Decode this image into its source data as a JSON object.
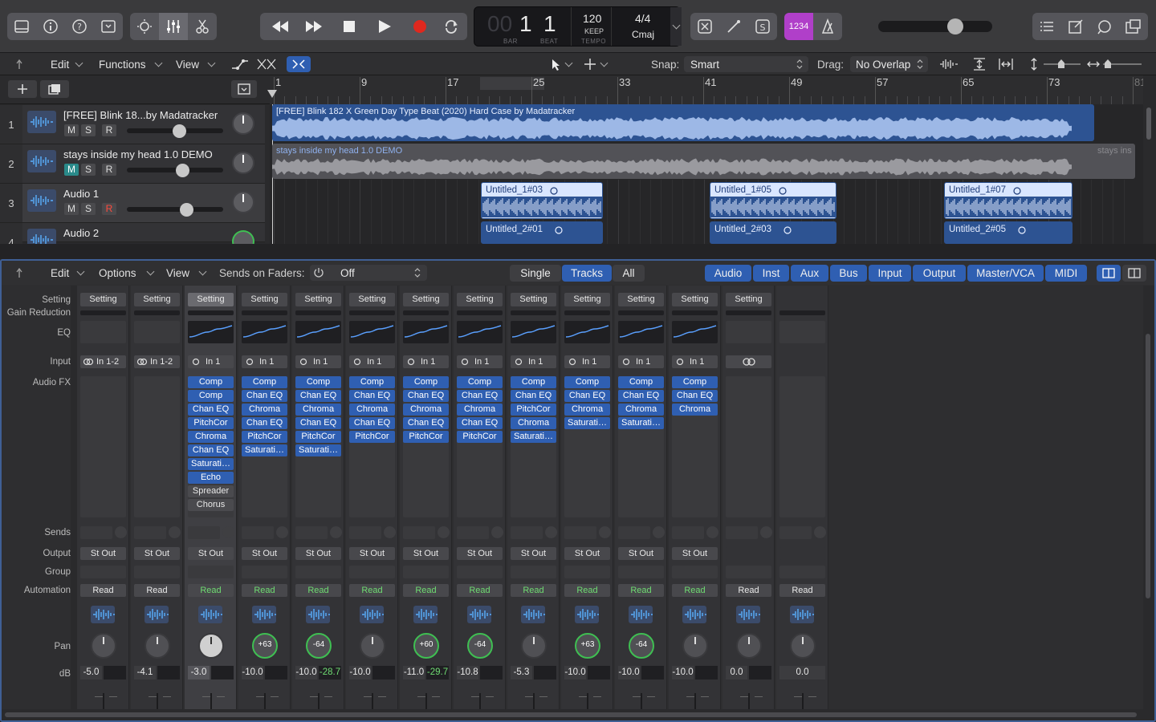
{
  "lcd": {
    "bar": "1",
    "beat": "1",
    "tempo": "120",
    "tempo_mode": "KEEP",
    "tempo_label": "TEMPO",
    "signature": "4/4",
    "key": "Cmaj",
    "bar_label": "BAR",
    "beat_label": "BEAT",
    "dim": "00"
  },
  "smart_controls": "1234",
  "tracks_toolbar": {
    "edit": "Edit",
    "functions": "Functions",
    "view": "View",
    "snap_label": "Snap:",
    "snap_value": "Smart",
    "drag_label": "Drag:",
    "drag_value": "No Overlap"
  },
  "ruler": [
    "1",
    "9",
    "17",
    "25",
    "33",
    "41",
    "49",
    "57",
    "65",
    "73",
    "81"
  ],
  "tracks": [
    {
      "num": "1",
      "name": "[FREE] Blink 18...by Madatracker",
      "m": "M",
      "s": "S",
      "r": "R",
      "volume": 0.52
    },
    {
      "num": "2",
      "name": "stays inside my head 1.0 DEMO",
      "m": "M",
      "s": "S",
      "r": "R",
      "volume": 0.55
    },
    {
      "num": "3",
      "name": "Audio 1",
      "m": "M",
      "s": "S",
      "r": "R",
      "volume": 0.6
    },
    {
      "num": "4",
      "name": "Audio 2"
    }
  ],
  "regions": {
    "r1": "[FREE] Blink 182 X Green Day Type Beat (2020) Hard Case by Madatracker",
    "r2": "stays inside my head 1.0 DEMO",
    "r2b": "stays ins",
    "a1": "Untitled_1#03",
    "a2": "Untitled_1#05",
    "a3": "Untitled_1#07",
    "b1": "Untitled_2#01",
    "b2": "Untitled_2#03",
    "b3": "Untitled_2#05"
  },
  "mixer_toolbar": {
    "edit": "Edit",
    "options": "Options",
    "view": "View",
    "sends_label": "Sends on Faders:",
    "sends_value": "Off",
    "single": "Single",
    "tracks": "Tracks",
    "all": "All",
    "filters": [
      "Audio",
      "Inst",
      "Aux",
      "Bus",
      "Input",
      "Output",
      "Master/VCA",
      "MIDI"
    ]
  },
  "row_labels": {
    "setting": "Setting",
    "gain": "Gain Reduction",
    "eq": "EQ",
    "input": "Input",
    "audiofx": "Audio FX",
    "sends": "Sends",
    "output": "Output",
    "group": "Group",
    "automation": "Automation",
    "pan": "Pan",
    "db": "dB"
  },
  "strips": [
    {
      "setting": "Setting",
      "input": "In 1-2",
      "stereo": true,
      "fx": [],
      "output": "St Out",
      "auto": "Read",
      "pan": "",
      "db": "-5.0",
      "peak": "",
      "eq": false
    },
    {
      "setting": "Setting",
      "input": "In 1-2",
      "stereo": true,
      "fx": [],
      "output": "St Out",
      "auto": "Read",
      "pan": "",
      "db": "-4.1",
      "peak": "",
      "eq": false
    },
    {
      "setting": "Setting",
      "input": "In 1",
      "fx": [
        "Comp",
        "Comp",
        "Chan EQ",
        "PitchCor",
        "Chroma",
        "Chan EQ",
        "Saturati…",
        "Echo",
        "Spreader",
        "Chorus"
      ],
      "output": "St Out",
      "auto": "Read",
      "pan": "",
      "db": "-3.0",
      "peak": "",
      "eq": true,
      "selected": true
    },
    {
      "setting": "Setting",
      "input": "In 1",
      "fx": [
        "Comp",
        "Chan EQ",
        "Chroma",
        "Chan EQ",
        "PitchCor",
        "Saturati…"
      ],
      "output": "St Out",
      "auto": "Read",
      "pan": "+63",
      "db": "-10.0",
      "peak": "",
      "eq": true
    },
    {
      "setting": "Setting",
      "input": "In 1",
      "fx": [
        "Comp",
        "Chan EQ",
        "Chroma",
        "Chan EQ",
        "PitchCor",
        "Saturati…"
      ],
      "output": "St Out",
      "auto": "Read",
      "pan": "-64",
      "db": "-10.0",
      "peak": "-28.7",
      "eq": true
    },
    {
      "setting": "Setting",
      "input": "In 1",
      "fx": [
        "Comp",
        "Chan EQ",
        "Chroma",
        "Chan EQ",
        "PitchCor"
      ],
      "output": "St Out",
      "auto": "Read",
      "pan": "",
      "db": "-10.0",
      "peak": "",
      "eq": true
    },
    {
      "setting": "Setting",
      "input": "In 1",
      "fx": [
        "Comp",
        "Chan EQ",
        "Chroma",
        "Chan EQ",
        "PitchCor"
      ],
      "output": "St Out",
      "auto": "Read",
      "pan": "+60",
      "db": "-11.0",
      "peak": "-29.7",
      "eq": true
    },
    {
      "setting": "Setting",
      "input": "In 1",
      "fx": [
        "Comp",
        "Chan EQ",
        "Chroma",
        "Chan EQ",
        "PitchCor"
      ],
      "output": "St Out",
      "auto": "Read",
      "pan": "-64",
      "db": "-10.8",
      "peak": "",
      "eq": true
    },
    {
      "setting": "Setting",
      "input": "In 1",
      "fx": [
        "Comp",
        "Chan EQ",
        "PitchCor",
        "Chroma",
        "Saturati…"
      ],
      "output": "St Out",
      "auto": "Read",
      "pan": "",
      "db": "-5.3",
      "peak": "",
      "eq": true
    },
    {
      "setting": "Setting",
      "input": "In 1",
      "fx": [
        "Comp",
        "Chan EQ",
        "Chroma",
        "Saturati…"
      ],
      "output": "St Out",
      "auto": "Read",
      "pan": "+63",
      "db": "-10.0",
      "peak": "",
      "eq": true
    },
    {
      "setting": "Setting",
      "input": "In 1",
      "fx": [
        "Comp",
        "Chan EQ",
        "Chroma",
        "Saturati…"
      ],
      "output": "St Out",
      "auto": "Read",
      "pan": "-64",
      "db": "-10.0",
      "peak": "",
      "eq": true
    },
    {
      "setting": "Setting",
      "input": "In 1",
      "fx": [
        "Comp",
        "Chan EQ",
        "Chroma"
      ],
      "output": "St Out",
      "auto": "Read",
      "pan": "",
      "db": "-10.0",
      "peak": "",
      "eq": true
    },
    {
      "setting": "Setting",
      "input": "",
      "link": true,
      "fx": [],
      "output": "",
      "auto": "Read",
      "pan": "",
      "db": "0.0",
      "peak": "",
      "eq": false
    },
    {
      "setting": "",
      "input": "",
      "fx": [],
      "output": "",
      "auto": "Read",
      "pan": "",
      "db": "0.0",
      "peak": "",
      "eq": false,
      "master": true
    }
  ],
  "colors": {
    "accent": "#2f5fb2",
    "record": "#e0281e",
    "green": "#4ecb5a",
    "smart": "#b03fc9"
  }
}
